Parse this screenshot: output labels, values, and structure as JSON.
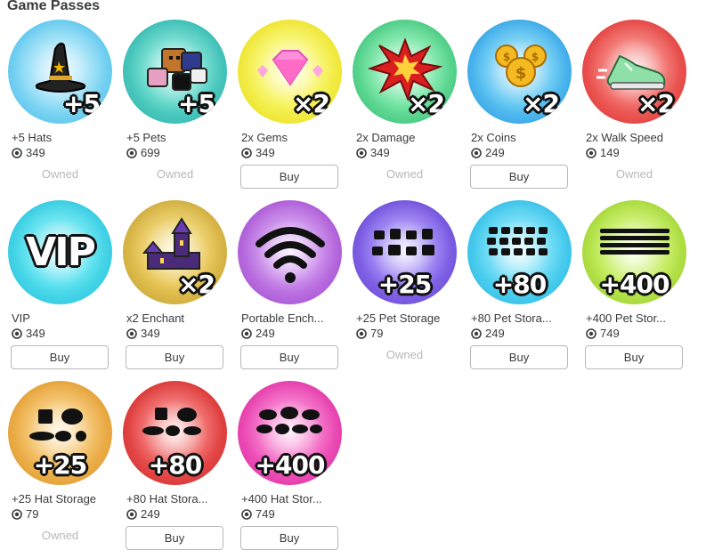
{
  "section": {
    "title": "Game Passes"
  },
  "passes": [
    {
      "name": "+5 Hats",
      "price": "349",
      "status": "Owned",
      "badge": "+5",
      "icon": "witch-hat-icon"
    },
    {
      "name": "+5 Pets",
      "price": "699",
      "status": "Owned",
      "badge": "+5",
      "icon": "pets-group-icon"
    },
    {
      "name": "2x Gems",
      "price": "349",
      "status": "Buy",
      "badge": "×2",
      "icon": "pink-gem-icon"
    },
    {
      "name": "2x Damage",
      "price": "349",
      "status": "Owned",
      "badge": "×2",
      "icon": "explosion-icon"
    },
    {
      "name": "2x Coins",
      "price": "249",
      "status": "Buy",
      "badge": "×2",
      "icon": "gold-coins-icon"
    },
    {
      "name": "2x Walk Speed",
      "price": "149",
      "status": "Owned",
      "badge": "×2",
      "icon": "sneaker-icon"
    },
    {
      "name": "VIP",
      "price": "349",
      "status": "Buy",
      "badge": "VIP",
      "icon": "vip-text-icon"
    },
    {
      "name": "x2 Enchant",
      "price": "349",
      "status": "Buy",
      "badge": "×2",
      "icon": "castle-tower-icon"
    },
    {
      "name": "Portable Ench...",
      "price": "249",
      "status": "Buy",
      "badge": "",
      "icon": "wifi-icon"
    },
    {
      "name": "+25 Pet Storage",
      "price": "79",
      "status": "Owned",
      "badge": "+25",
      "icon": "pet-silhouettes-icon"
    },
    {
      "name": "+80 Pet Stora...",
      "price": "249",
      "status": "Buy",
      "badge": "+80",
      "icon": "pet-silhouettes-icon"
    },
    {
      "name": "+400 Pet Stor...",
      "price": "749",
      "status": "Buy",
      "badge": "+400",
      "icon": "pet-silhouettes-icon"
    },
    {
      "name": "+25 Hat Storage",
      "price": "79",
      "status": "Owned",
      "badge": "+25",
      "icon": "hat-silhouettes-icon"
    },
    {
      "name": "+80 Hat Stora...",
      "price": "249",
      "status": "Buy",
      "badge": "+80",
      "icon": "hat-silhouettes-icon"
    },
    {
      "name": "+400 Hat Stor...",
      "price": "749",
      "status": "Buy",
      "badge": "+400",
      "icon": "hat-silhouettes-icon"
    }
  ],
  "colors": {
    "text": "#393b3d",
    "owned": "#b8b8b8",
    "button_border": "#b8b8b8"
  }
}
